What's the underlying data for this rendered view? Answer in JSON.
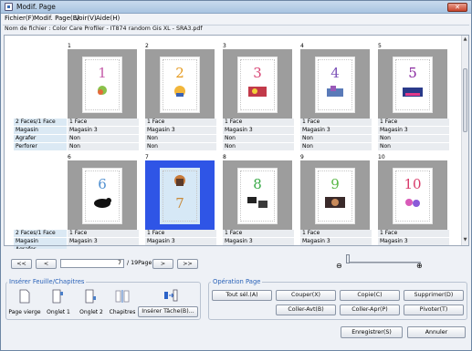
{
  "window": {
    "title": "Modif. Page",
    "close": "✕"
  },
  "menu": [
    {
      "label": "Fichier(F)"
    },
    {
      "label": "Modif. Page(E)"
    },
    {
      "label": "Voir(V)"
    },
    {
      "label": "Aide(H)"
    }
  ],
  "filename": "Nom de fichier : Color Care Profiler - IT874 random Gis XL - SRA3.pdf",
  "row_labels": [
    "2 Faces/1 Face",
    "Magasin",
    "Agrafer",
    "Perforer"
  ],
  "row_labels_2": [
    "2 Faces/1 Face",
    "Magasin",
    "Agrafer"
  ],
  "pages_row1": [
    {
      "num": "1",
      "digit": "1",
      "digit_color": "#c45aa8",
      "values": [
        "1 Face",
        "Magasin 3",
        "Non",
        "Non"
      ]
    },
    {
      "num": "2",
      "digit": "2",
      "digit_color": "#e59a1f",
      "values": [
        "1 Face",
        "Magasin 3",
        "Non",
        "Non"
      ]
    },
    {
      "num": "3",
      "digit": "3",
      "digit_color": "#d84575",
      "values": [
        "1 Face",
        "Magasin 3",
        "Non",
        "Non"
      ]
    },
    {
      "num": "4",
      "digit": "4",
      "digit_color": "#7c52b8",
      "values": [
        "1 Face",
        "Magasin 3",
        "Non",
        "Non"
      ]
    },
    {
      "num": "5",
      "digit": "5",
      "digit_color": "#8a2aa0",
      "values": [
        "1 Face",
        "Magasin 3",
        "Non",
        "Non"
      ]
    }
  ],
  "pages_row2": [
    {
      "num": "6",
      "digit": "6",
      "digit_color": "#4f8fd0",
      "values": [
        "1 Face",
        "Magasin 3",
        "Non"
      ],
      "selected": false
    },
    {
      "num": "7",
      "digit": "7",
      "digit_color": "#c88a3a",
      "values": [
        "1 Face",
        "Magasin 3",
        "Non"
      ],
      "selected": true
    },
    {
      "num": "8",
      "digit": "8",
      "digit_color": "#3aaa48",
      "values": [
        "1 Face",
        "Magasin 3",
        "Non"
      ],
      "selected": false
    },
    {
      "num": "9",
      "digit": "9",
      "digit_color": "#5ab848",
      "values": [
        "1 Face",
        "Magasin 3",
        "Non"
      ],
      "selected": false
    },
    {
      "num": "10",
      "digit": "10",
      "digit_color": "#d83a6a",
      "values": [
        "1 Face",
        "Magasin 3",
        "Non"
      ],
      "selected": false
    }
  ],
  "nav": {
    "first": "<<",
    "prev": "<",
    "next": ">",
    "last": ">>",
    "page_value": "7",
    "page_total": "/ 19Page"
  },
  "insert_group": {
    "title": "Insérer Feuille/Chapitres",
    "tools": [
      "Page vierge",
      "Onglet 1",
      "Onglet 2",
      "Chapitres"
    ],
    "insert_task": "Insérer Tâche(B)..."
  },
  "operation_group": {
    "title": "Opération Page",
    "buttons": [
      "Tout sél.(A)",
      "Couper(X)",
      "Copie(C)",
      "Supprimer(D)",
      "Coller-Avt(B)",
      "Coller-Apr(P)",
      "Pivoter(T)"
    ]
  },
  "footer": {
    "save": "Enregistrer(S)",
    "cancel": "Annuler"
  }
}
